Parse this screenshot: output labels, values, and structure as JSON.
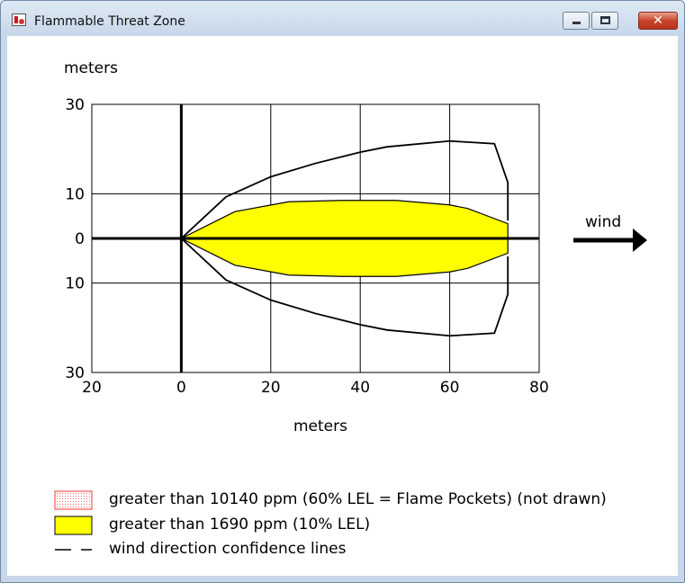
{
  "window": {
    "title": "Flammable Threat Zone",
    "minimize_label": "minimize",
    "maximize_label": "maximize",
    "close_symbol": "✕",
    "app_icon": "flame-icon"
  },
  "chart_data": {
    "type": "area",
    "ylabel": "meters",
    "xlabel": "meters",
    "xlim": [
      -20,
      80
    ],
    "ylim": [
      -30,
      30
    ],
    "x_ticks": [
      -20,
      0,
      20,
      40,
      60,
      80
    ],
    "x_tick_labels": [
      "20",
      "0",
      "20",
      "40",
      "60",
      "80"
    ],
    "y_ticks": [
      30,
      10,
      0,
      -10,
      -30
    ],
    "y_tick_labels": [
      "30",
      "10",
      "0",
      "10",
      "30"
    ],
    "grid": true,
    "wind_label": "wind",
    "wind_direction": "right",
    "threat_zone": {
      "color": "#ffff00",
      "upper": [
        [
          0,
          0
        ],
        [
          12,
          6
        ],
        [
          24,
          8.2
        ],
        [
          36,
          8.5
        ],
        [
          48,
          8.5
        ],
        [
          60,
          7.5
        ],
        [
          64,
          6.7
        ],
        [
          73,
          3.3
        ],
        [
          73,
          0
        ]
      ],
      "lower": [
        [
          0,
          0
        ],
        [
          12,
          -6
        ],
        [
          24,
          -8.2
        ],
        [
          36,
          -8.5
        ],
        [
          48,
          -8.5
        ],
        [
          60,
          -7.5
        ],
        [
          64,
          -6.7
        ],
        [
          73,
          -3.3
        ],
        [
          73,
          0
        ]
      ]
    },
    "confidence_lines": {
      "color": "#000000",
      "upper": [
        [
          0,
          0
        ],
        [
          10,
          9.3
        ],
        [
          20,
          13.8
        ],
        [
          30,
          16.8
        ],
        [
          40,
          19.3
        ],
        [
          46,
          20.5
        ],
        [
          60,
          21.8
        ],
        [
          70,
          21.2
        ],
        [
          73,
          12.5
        ],
        [
          73,
          4
        ]
      ],
      "lower": [
        [
          0,
          0
        ],
        [
          10,
          -9.3
        ],
        [
          20,
          -13.8
        ],
        [
          30,
          -16.8
        ],
        [
          40,
          -19.3
        ],
        [
          46,
          -20.5
        ],
        [
          60,
          -21.8
        ],
        [
          70,
          -21.2
        ],
        [
          73,
          -12.5
        ],
        [
          73,
          -4
        ]
      ]
    },
    "legend": [
      {
        "label": "greater than 10140 ppm (60% LEL = Flame Pockets) (not drawn)",
        "swatch": "red-dotted",
        "color": "#ff6b6b"
      },
      {
        "label": "greater than 1690 ppm (10% LEL)",
        "swatch": "solid",
        "color": "#ffff00"
      },
      {
        "label": "wind direction confidence lines",
        "swatch": "dash",
        "color": "#000000"
      }
    ]
  }
}
